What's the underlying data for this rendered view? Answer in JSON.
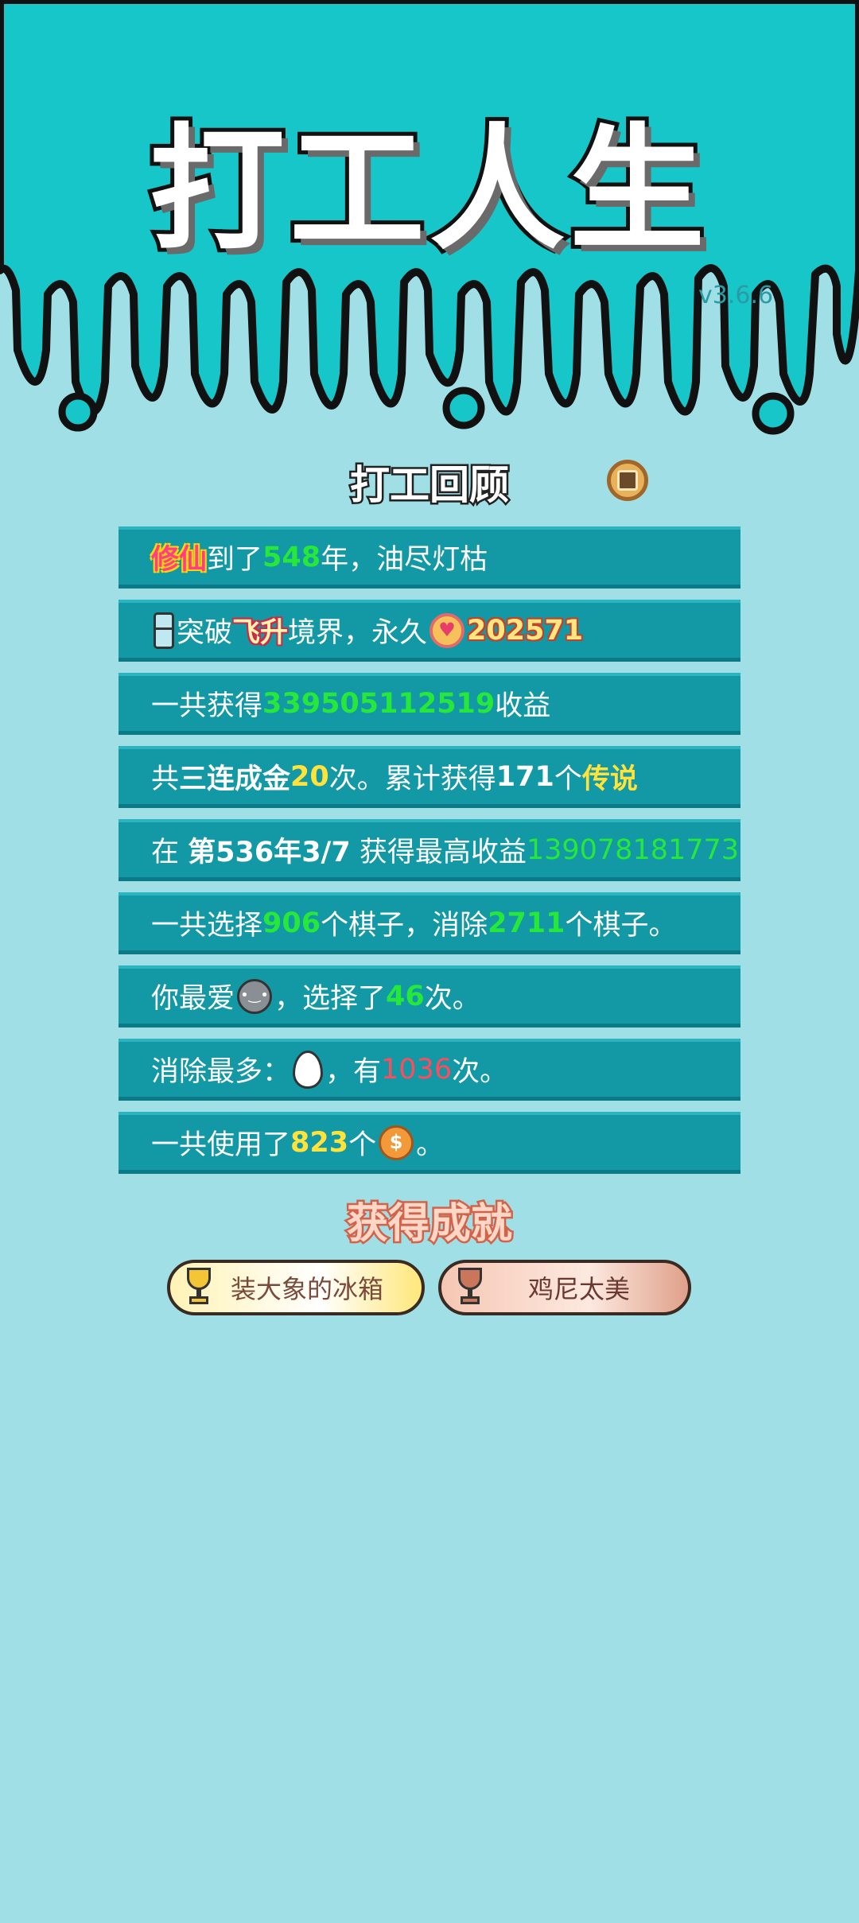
{
  "header": {
    "game_title": "打工人生",
    "version": "v3.6.6"
  },
  "review": {
    "title": "打工回顾",
    "coin_icon": "gold-coin-icon",
    "rows": {
      "r1": {
        "a": "修仙",
        "b": "到了",
        "c": "548",
        "d": "年，油尽灯枯"
      },
      "r2": {
        "a": "突破",
        "b": "飞升",
        "c": "境界，永久",
        "d": "202571"
      },
      "r3": {
        "a": "一共获得",
        "b": "339505112519",
        "c": "收益"
      },
      "r4": {
        "a": "共",
        "b": "三连成金",
        "c": "20",
        "d": "次。累计获得",
        "e": "171",
        "f": "个",
        "g": "传说"
      },
      "r5": {
        "a": "在 ",
        "b": "第536年3/7",
        "c": " 获得最高收益",
        "d": "139078181773"
      },
      "r6": {
        "a": "一共选择",
        "b": "906",
        "c": "个棋子，消除",
        "d": "2711",
        "e": "个棋子。"
      },
      "r7": {
        "a": "你最爱",
        "b": "，选择了",
        "c": "46",
        "d": "次。"
      },
      "r8": {
        "a": "消除最多：",
        "b": "，有",
        "c": "1036",
        "d": "次。"
      },
      "r9": {
        "a": "一共使用了",
        "b": "823",
        "c": "个",
        "d": "。"
      }
    },
    "icons": [
      "fridge-icon",
      "heart-coin-icon",
      "rice-bowl-icon",
      "egg-icon",
      "dollar-coin-icon"
    ]
  },
  "achievements": {
    "title": "获得成就",
    "items": [
      {
        "label": "装大象的冰箱",
        "tier": "gold",
        "color": "#f4c534"
      },
      {
        "label": "鸡尼太美",
        "tier": "bronze",
        "color": "#c9765a"
      }
    ]
  },
  "colors": {
    "header_bg": "#17c6c8",
    "page_bg": "#a0dfe6",
    "row_bg": "#1398a6",
    "highlight_green": "#25e83a",
    "highlight_yellow": "#ffe33a",
    "highlight_red": "#ff4c5c"
  }
}
